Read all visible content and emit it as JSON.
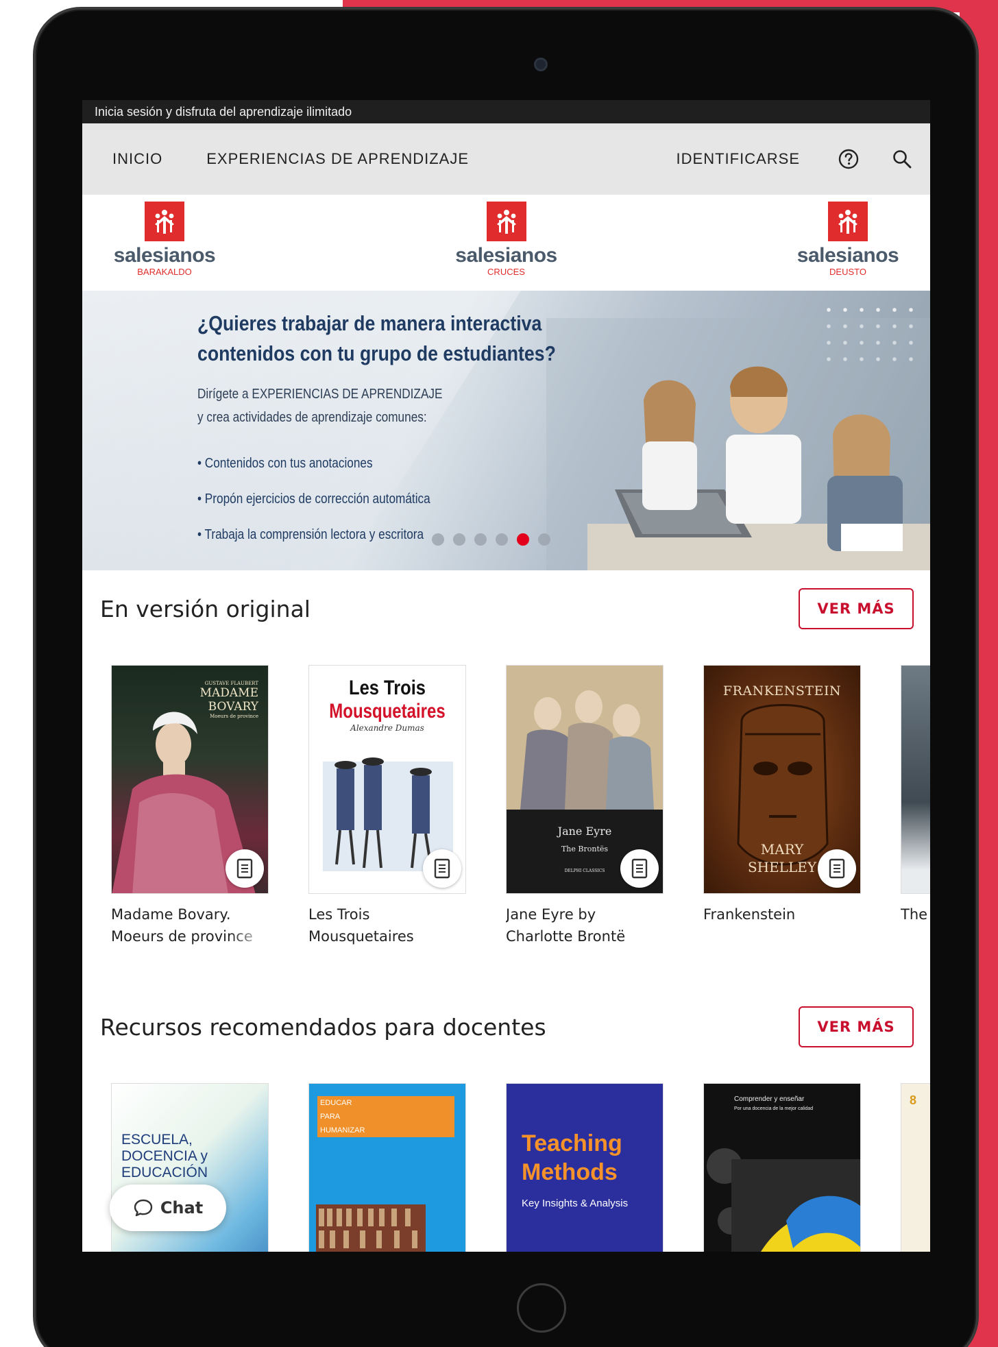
{
  "top_banner": {
    "text": "Inicia sesión y disfruta del aprendizaje ilimitado"
  },
  "nav": {
    "items": [
      "INICIO",
      "EXPERIENCIAS DE APRENDIZAJE"
    ],
    "login": "IDENTIFICARSE",
    "help_icon": "help-circle-icon",
    "search_icon": "search-icon"
  },
  "logos": [
    {
      "name": "salesianos",
      "sub": "BARAKALDO"
    },
    {
      "name": "salesianos",
      "sub": "CRUCES"
    },
    {
      "name": "salesianos",
      "sub": "DEUSTO"
    }
  ],
  "hero": {
    "title_line1": "¿Quieres trabajar de manera interactiva",
    "title_line2": "contenidos con tu grupo de estudiantes?",
    "sub_line1": "Dirígete a EXPERIENCIAS DE APRENDIZAJE",
    "sub_line2": "y crea actividades de aprendizaje comunes:",
    "bullets": [
      "• Contenidos con tus anotaciones",
      "• Propón ejercicios de corrección automática",
      "• Trabaja la comprensión lectora y escritora"
    ],
    "carousel": {
      "count": 6,
      "active_index": 4
    }
  },
  "section_original": {
    "title": "En versión original",
    "button": "VER MÁS",
    "books": [
      {
        "title": "Madame Bovary. Moeurs de province",
        "cover_text_1": "GUSTAVE FLAUBERT",
        "cover_text_2": "MADAME",
        "cover_text_3": "BOVARY",
        "cover_text_4": "Moeurs de province"
      },
      {
        "title": "Les Trois Mousquetaires",
        "cover_text_1": "Les Trois",
        "cover_text_2": "Mousquetaires",
        "cover_text_3": "Alexandre Dumas"
      },
      {
        "title": "Jane Eyre by Charlotte Brontë",
        "cover_text_1": "Jane Eyre",
        "cover_text_2": "The Brontës",
        "cover_text_3": "DELPHI CLASSICS"
      },
      {
        "title": "Frankenstein",
        "cover_text_1": "FRANKENSTEIN",
        "cover_text_2": "MARY",
        "cover_text_3": "SHELLEY"
      },
      {
        "title": "The Sh"
      }
    ]
  },
  "section_docentes": {
    "title": "Recursos recomendados para docentes",
    "button": "VER MÁS",
    "books": [
      {
        "cover_text_1": "ESCUELA,",
        "cover_text_2": "DOCENCIA y",
        "cover_text_3": "EDUCACIÓN"
      },
      {
        "cover_text_1": "EDUCAR",
        "cover_text_2": "PARA",
        "cover_text_3": "HUMANIZAR"
      },
      {
        "cover_text_1": "Teaching",
        "cover_text_2": "Methods",
        "cover_text_3": "Key Insights & Analysis"
      },
      {
        "cover_text_1": "Comprender y enseñar",
        "cover_text_2": "Por una docencia de la mejor calidad"
      },
      {
        "cover_text_1": "8"
      }
    ]
  },
  "chat": {
    "label": "Chat"
  },
  "colors": {
    "accent_red": "#c8102e",
    "brand_red": "#e02c2c",
    "nav_bg": "#e6e6e6",
    "frame_red": "#e0344c"
  }
}
